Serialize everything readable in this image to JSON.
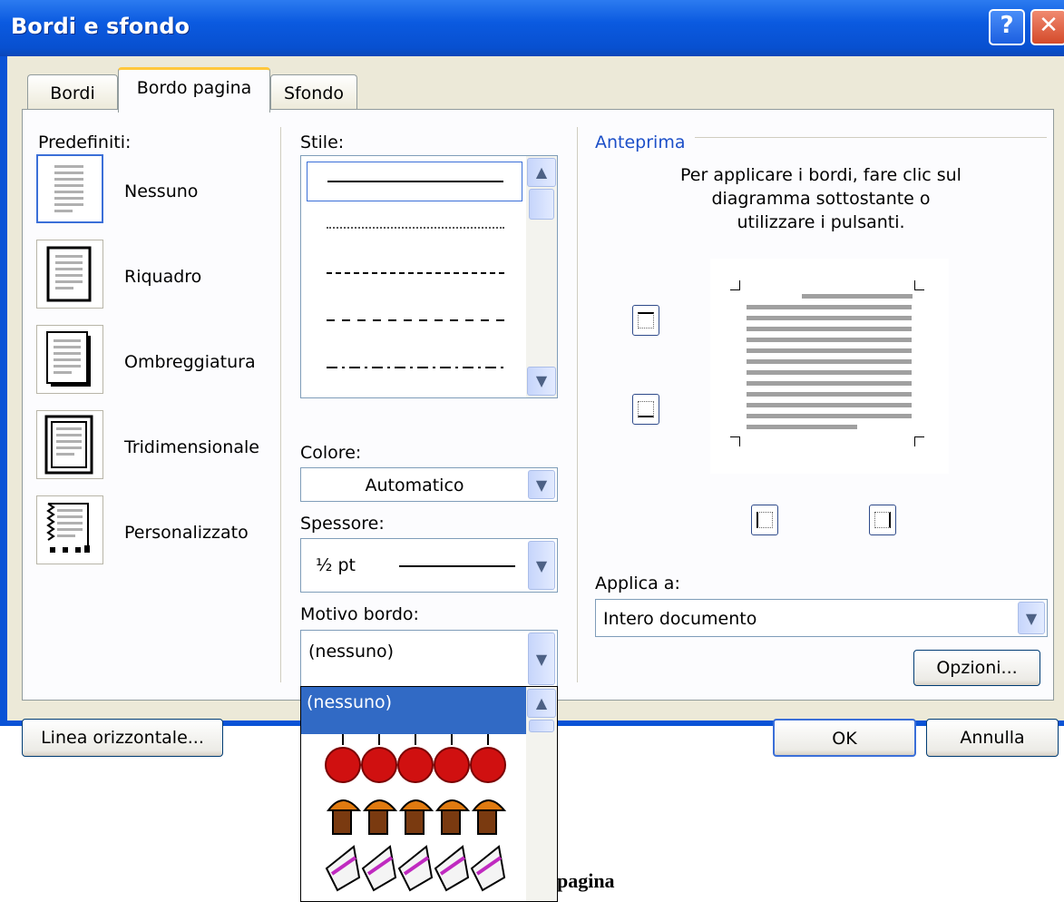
{
  "window": {
    "title": "Bordi e sfondo",
    "help_glyph": "?",
    "close_glyph": "✕"
  },
  "tabs": [
    {
      "label": "Bordi",
      "active": false
    },
    {
      "label": "Bordo pagina",
      "active": true
    },
    {
      "label": "Sfondo",
      "active": false
    }
  ],
  "presets": {
    "label": "Predefiniti:",
    "items": [
      {
        "label": "Nessuno",
        "icon": "preset-none-icon",
        "selected": true
      },
      {
        "label": "Riquadro",
        "icon": "preset-box-icon",
        "selected": false
      },
      {
        "label": "Ombreggiatura",
        "icon": "preset-shadow-icon",
        "selected": false
      },
      {
        "label": "Tridimensionale",
        "icon": "preset-3d-icon",
        "selected": false
      },
      {
        "label": "Personalizzato",
        "icon": "preset-custom-icon",
        "selected": false
      }
    ]
  },
  "style": {
    "label": "Stile:",
    "options": [
      "solid",
      "dotted",
      "dashed-fine",
      "dashed",
      "dash-dot"
    ],
    "selected_index": 0
  },
  "color": {
    "label": "Colore:",
    "value": "Automatico"
  },
  "width": {
    "label": "Spessore:",
    "value": "½ pt"
  },
  "art": {
    "label": "Motivo bordo:",
    "value": "(nessuno)",
    "dropdown_items": [
      {
        "label": "(nessuno)",
        "selected": true
      },
      {
        "label": "",
        "icon": "apples-art-icon"
      },
      {
        "label": "",
        "icon": "cupcakes-art-icon"
      },
      {
        "label": "",
        "icon": "cake-slices-art-icon"
      }
    ]
  },
  "preview": {
    "label": "Anteprima",
    "instructions": [
      "Per applicare i bordi, fare clic sul",
      "diagramma sottostante o",
      "utilizzare i pulsanti."
    ]
  },
  "apply_to": {
    "label": "Applica a:",
    "value": "Intero documento"
  },
  "buttons": {
    "options": "Opzioni...",
    "horizontal_line": "Linea orizzontale...",
    "ok": "OK",
    "cancel": "Annulla"
  },
  "caption": "Motivi della pagina",
  "colors": {
    "title_bar": "#0a53d6",
    "dialog_bg": "#ece9d8",
    "selection": "#316ac5",
    "apple": "#d01010"
  }
}
